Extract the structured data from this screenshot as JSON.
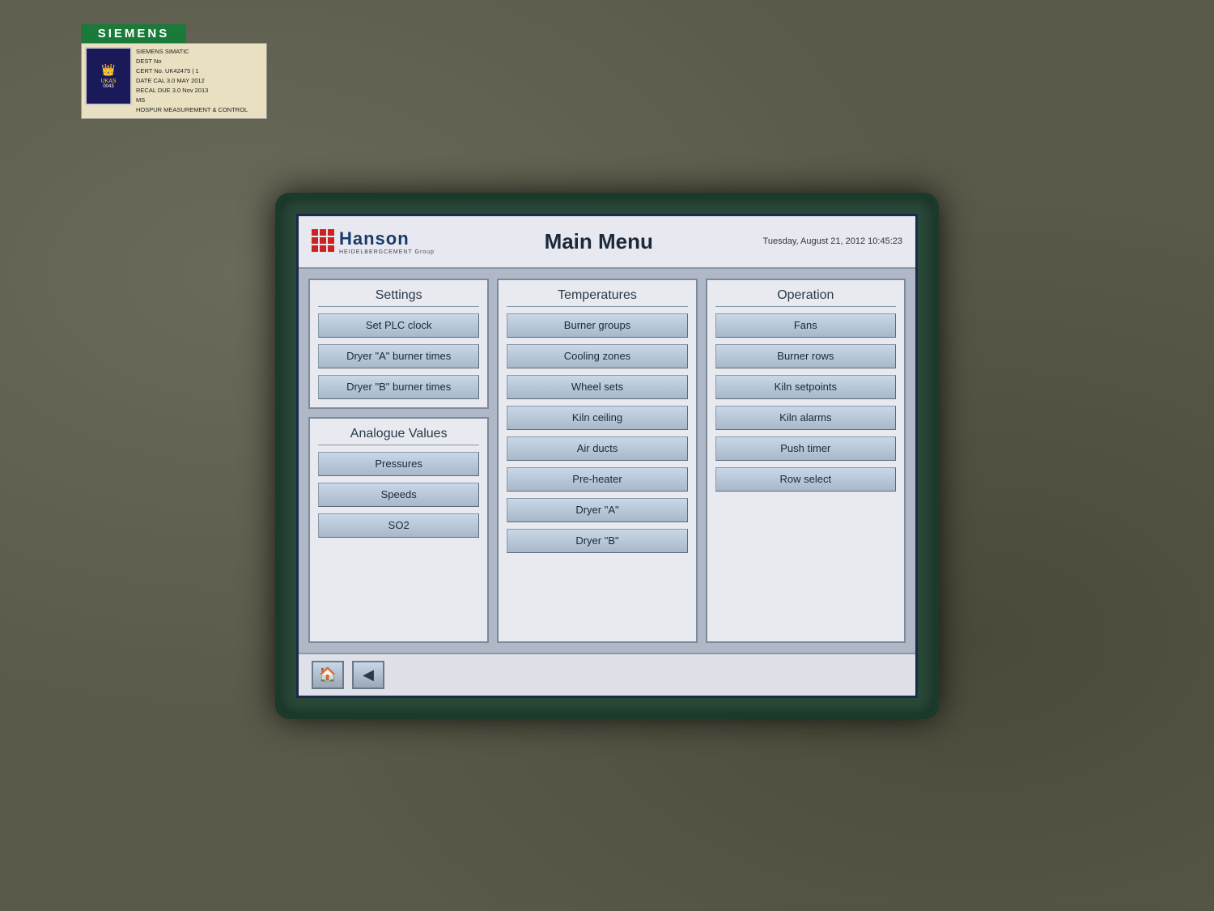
{
  "background": {
    "color": "#5a5a4a"
  },
  "siemens": {
    "label": "SIEMENS"
  },
  "header": {
    "datetime": "Tuesday, August 21, 2012 10:45:23",
    "title": "Main Menu",
    "logo_name": "Hanson",
    "logo_sub": "HEIDELBERGCEMENT Group"
  },
  "columns": {
    "settings": {
      "header": "Settings",
      "buttons": [
        "Set PLC clock",
        "Dryer \"A\" burner times",
        "Dryer \"B\" burner times"
      ]
    },
    "analogue": {
      "header": "Analogue Values",
      "buttons": [
        "Pressures",
        "Speeds",
        "SO2"
      ]
    },
    "temperatures": {
      "header": "Temperatures",
      "buttons": [
        "Burner groups",
        "Cooling zones",
        "Wheel sets",
        "Kiln ceiling",
        "Air ducts",
        "Pre-heater",
        "Dryer \"A\"",
        "Dryer \"B\""
      ]
    },
    "operation": {
      "header": "Operation",
      "buttons": [
        "Fans",
        "Burner rows",
        "Kiln setpoints",
        "Kiln alarms",
        "Push timer",
        "Row select"
      ]
    }
  },
  "footer": {
    "home_icon": "🏠",
    "back_icon": "◀"
  }
}
